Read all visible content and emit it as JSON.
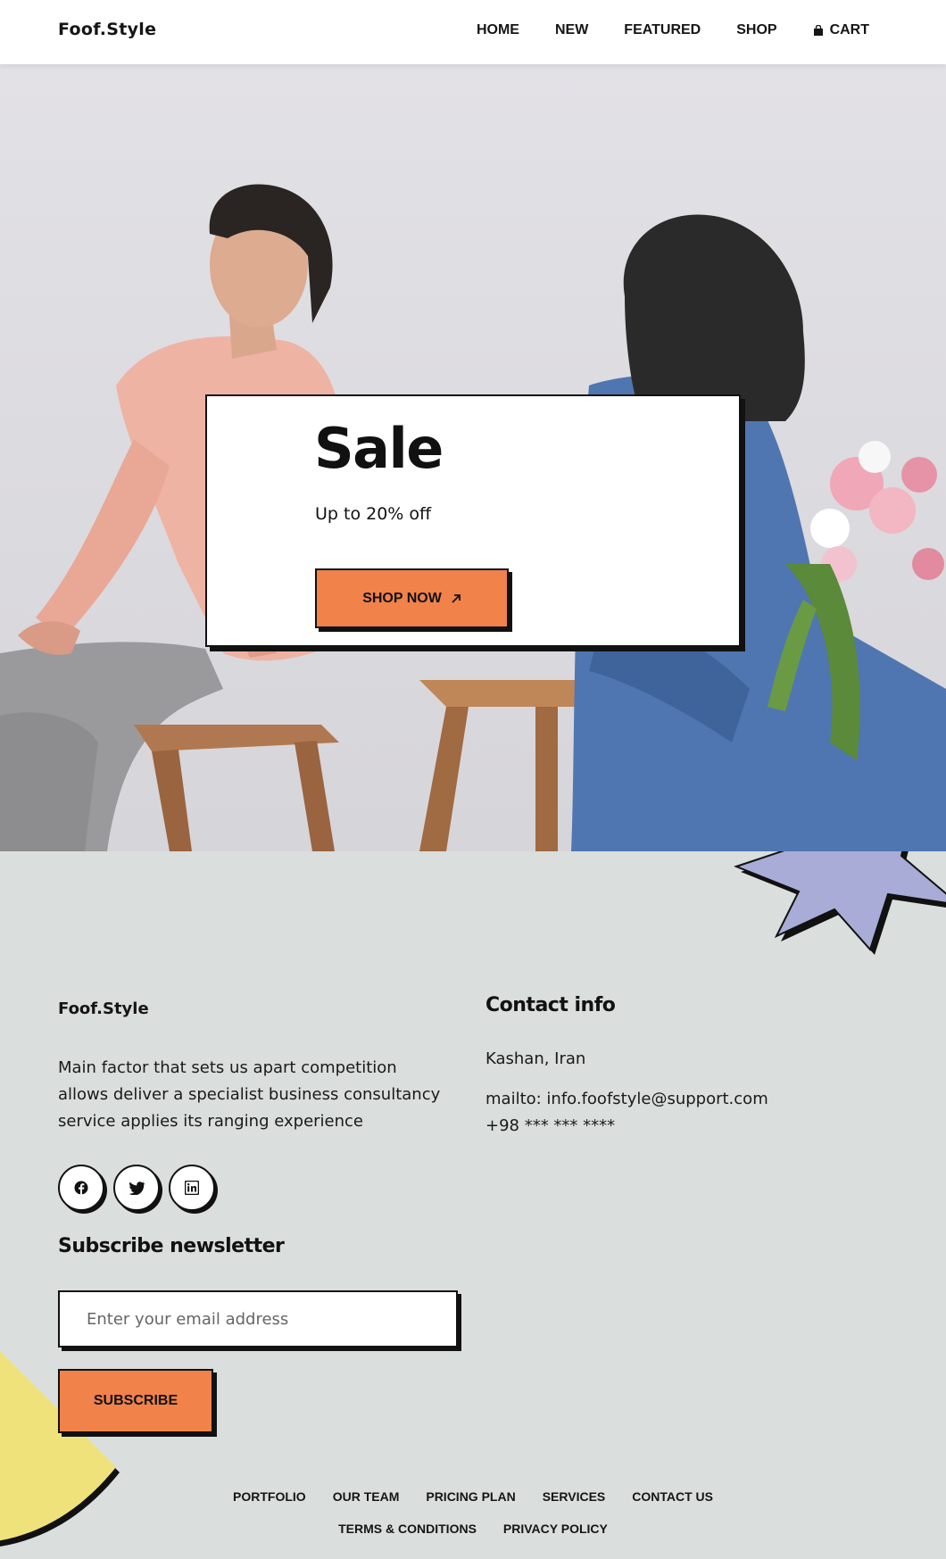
{
  "header": {
    "brand": "Foof.Style",
    "nav": [
      {
        "label": "HOME"
      },
      {
        "label": "NEW"
      },
      {
        "label": "FEATURED"
      },
      {
        "label": "SHOP"
      },
      {
        "label": "CART",
        "icon": "shopping-bag-icon"
      }
    ]
  },
  "hero": {
    "title": "Sale",
    "subtitle": "Up to 20% off",
    "cta_label": "SHOP NOW",
    "cta_icon": "arrow-up-right-icon",
    "image": "photo-man-and-woman-on-wooden-stools-with-flowers"
  },
  "footer": {
    "brand": "Foof.Style",
    "description": "Main factor that sets us apart competition allows deliver a specialist business consultancy service applies its ranging experience",
    "socials": [
      "facebook-icon",
      "twitter-icon",
      "linkedin-icon"
    ],
    "newsletter": {
      "title": "Subscribe newsletter",
      "placeholder": "Enter your email address",
      "button_label": "SUBSCRIBE"
    },
    "contact": {
      "title": "Contact info",
      "location": "Kashan, Iran",
      "email": "mailto: info.foofstyle@support.com",
      "phone": "+98 *** *** ****"
    },
    "links_row1": [
      "PORTFOLIO",
      "OUR TEAM",
      "PRICING PLAN",
      "SERVICES",
      "CONTACT US"
    ],
    "links_row2": [
      "TERMS & CONDITIONS",
      "PRIVACY POLICY"
    ]
  },
  "colors": {
    "accent": "#f0824a",
    "footer_bg": "#dadedd",
    "star": "#a8acd6",
    "blob": "#efe27a",
    "ink": "#111111"
  }
}
